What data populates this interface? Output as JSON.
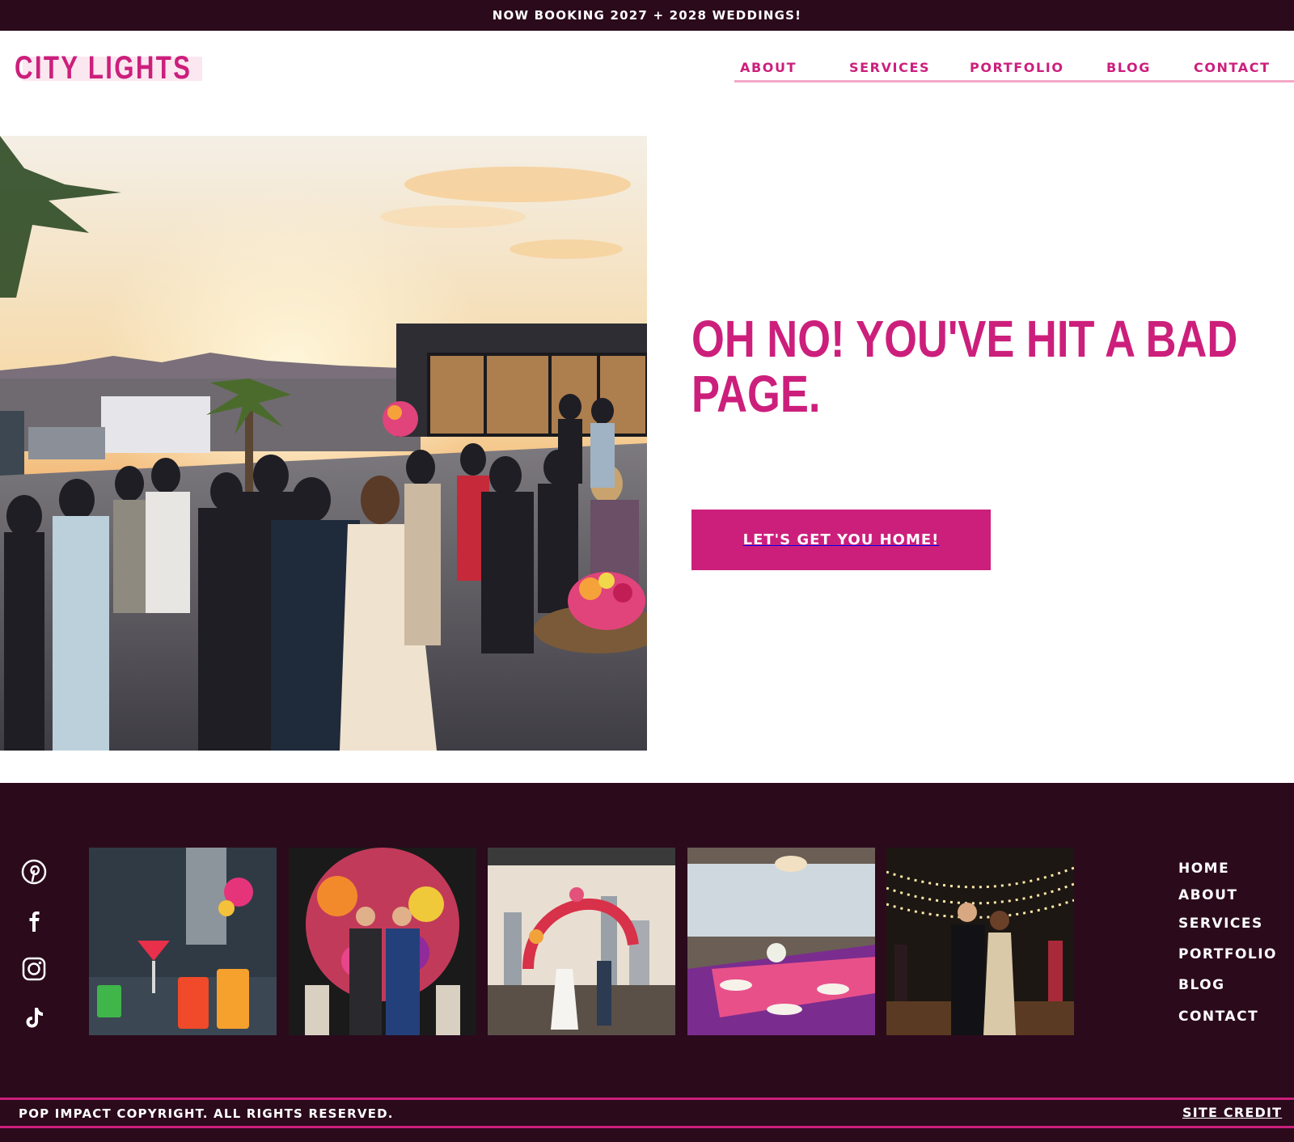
{
  "announcement": "NOW BOOKING 2027 + 2028 WEDDINGS!",
  "brand": {
    "logo_text": "CITY LIGHTS"
  },
  "nav": {
    "items": [
      "ABOUT",
      "SERVICES",
      "PORTFOLIO",
      "BLOG",
      "CONTACT"
    ]
  },
  "hero": {
    "headline_line1": "OH NO! YOU'VE HIT A BAD",
    "headline_line2": "PAGE.",
    "cta_label": "LET'S GET YOU HOME!"
  },
  "footer": {
    "social_icons": [
      "pinterest-icon",
      "facebook-icon",
      "instagram-icon",
      "tiktok-icon"
    ],
    "nav_items": [
      "HOME",
      "ABOUT",
      "SERVICES",
      "PORTFOLIO",
      "BLOG",
      "CONTACT"
    ],
    "copyright": "POP IMPACT COPYRIGHT. ALL RIGHTS RESERVED.",
    "site_credit": "SITE CREDIT"
  },
  "colors": {
    "brand_pink": "#cc1f7c",
    "dark_plum": "#2b0a1c",
    "light_pink": "#f2a9c8"
  }
}
